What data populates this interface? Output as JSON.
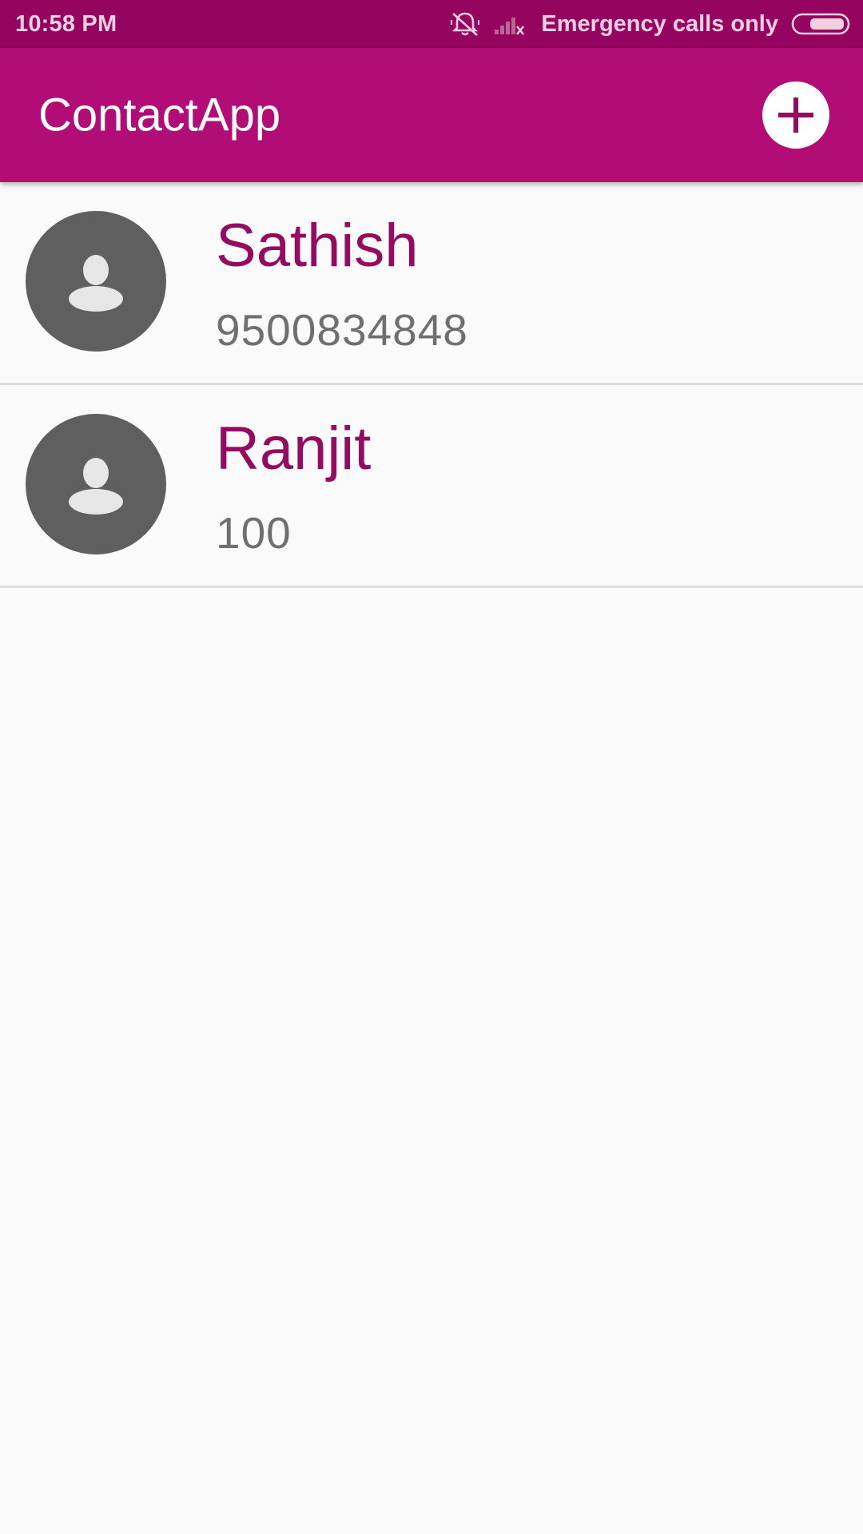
{
  "status_bar": {
    "time": "10:58 PM",
    "carrier": "Emergency calls only",
    "icons": [
      "bell-off-icon",
      "signal-no-service-icon",
      "battery-icon"
    ],
    "background": "#95045e"
  },
  "app_bar": {
    "title": "ContactApp",
    "action_icon": "plus-icon",
    "background": "#b20c76"
  },
  "contacts": [
    {
      "name": "Sathish",
      "phone": "9500834848",
      "avatar_icon": "person-icon"
    },
    {
      "name": "Ranjit",
      "phone": "100",
      "avatar_icon": "person-icon"
    }
  ],
  "colors": {
    "name_text": "#950b62",
    "phone_text": "#6f6f6f",
    "avatar_bg": "#5f5f5f",
    "page_bg": "#fafafa"
  }
}
